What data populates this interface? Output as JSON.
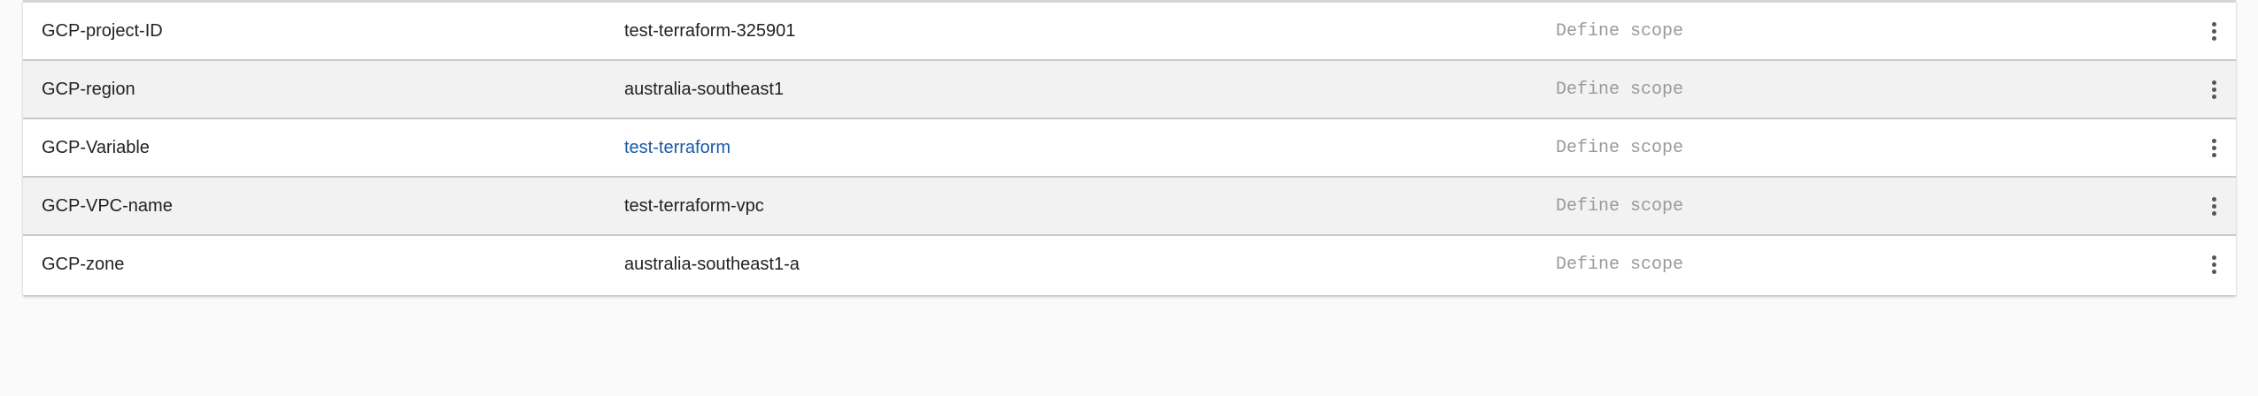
{
  "variables": {
    "rows": [
      {
        "name": "GCP-project-ID",
        "value": "test-terraform-325901",
        "scope": "Define scope",
        "value_is_link": false
      },
      {
        "name": "GCP-region",
        "value": "australia-southeast1",
        "scope": "Define scope",
        "value_is_link": false
      },
      {
        "name": "GCP-Variable",
        "value": "test-terraform",
        "scope": "Define scope",
        "value_is_link": true
      },
      {
        "name": "GCP-VPC-name",
        "value": "test-terraform-vpc",
        "scope": "Define scope",
        "value_is_link": false
      },
      {
        "name": "GCP-zone",
        "value": "australia-southeast1-a",
        "scope": "Define scope",
        "value_is_link": false
      }
    ],
    "row_menu_icon": "more-vert-icon"
  },
  "colors": {
    "page_background": "#fafafa",
    "row_background": "#ffffff",
    "row_alt_background": "#f2f2f2",
    "text": "#222222",
    "link": "#1a5aa6",
    "scope_text": "#9a9a9a"
  }
}
